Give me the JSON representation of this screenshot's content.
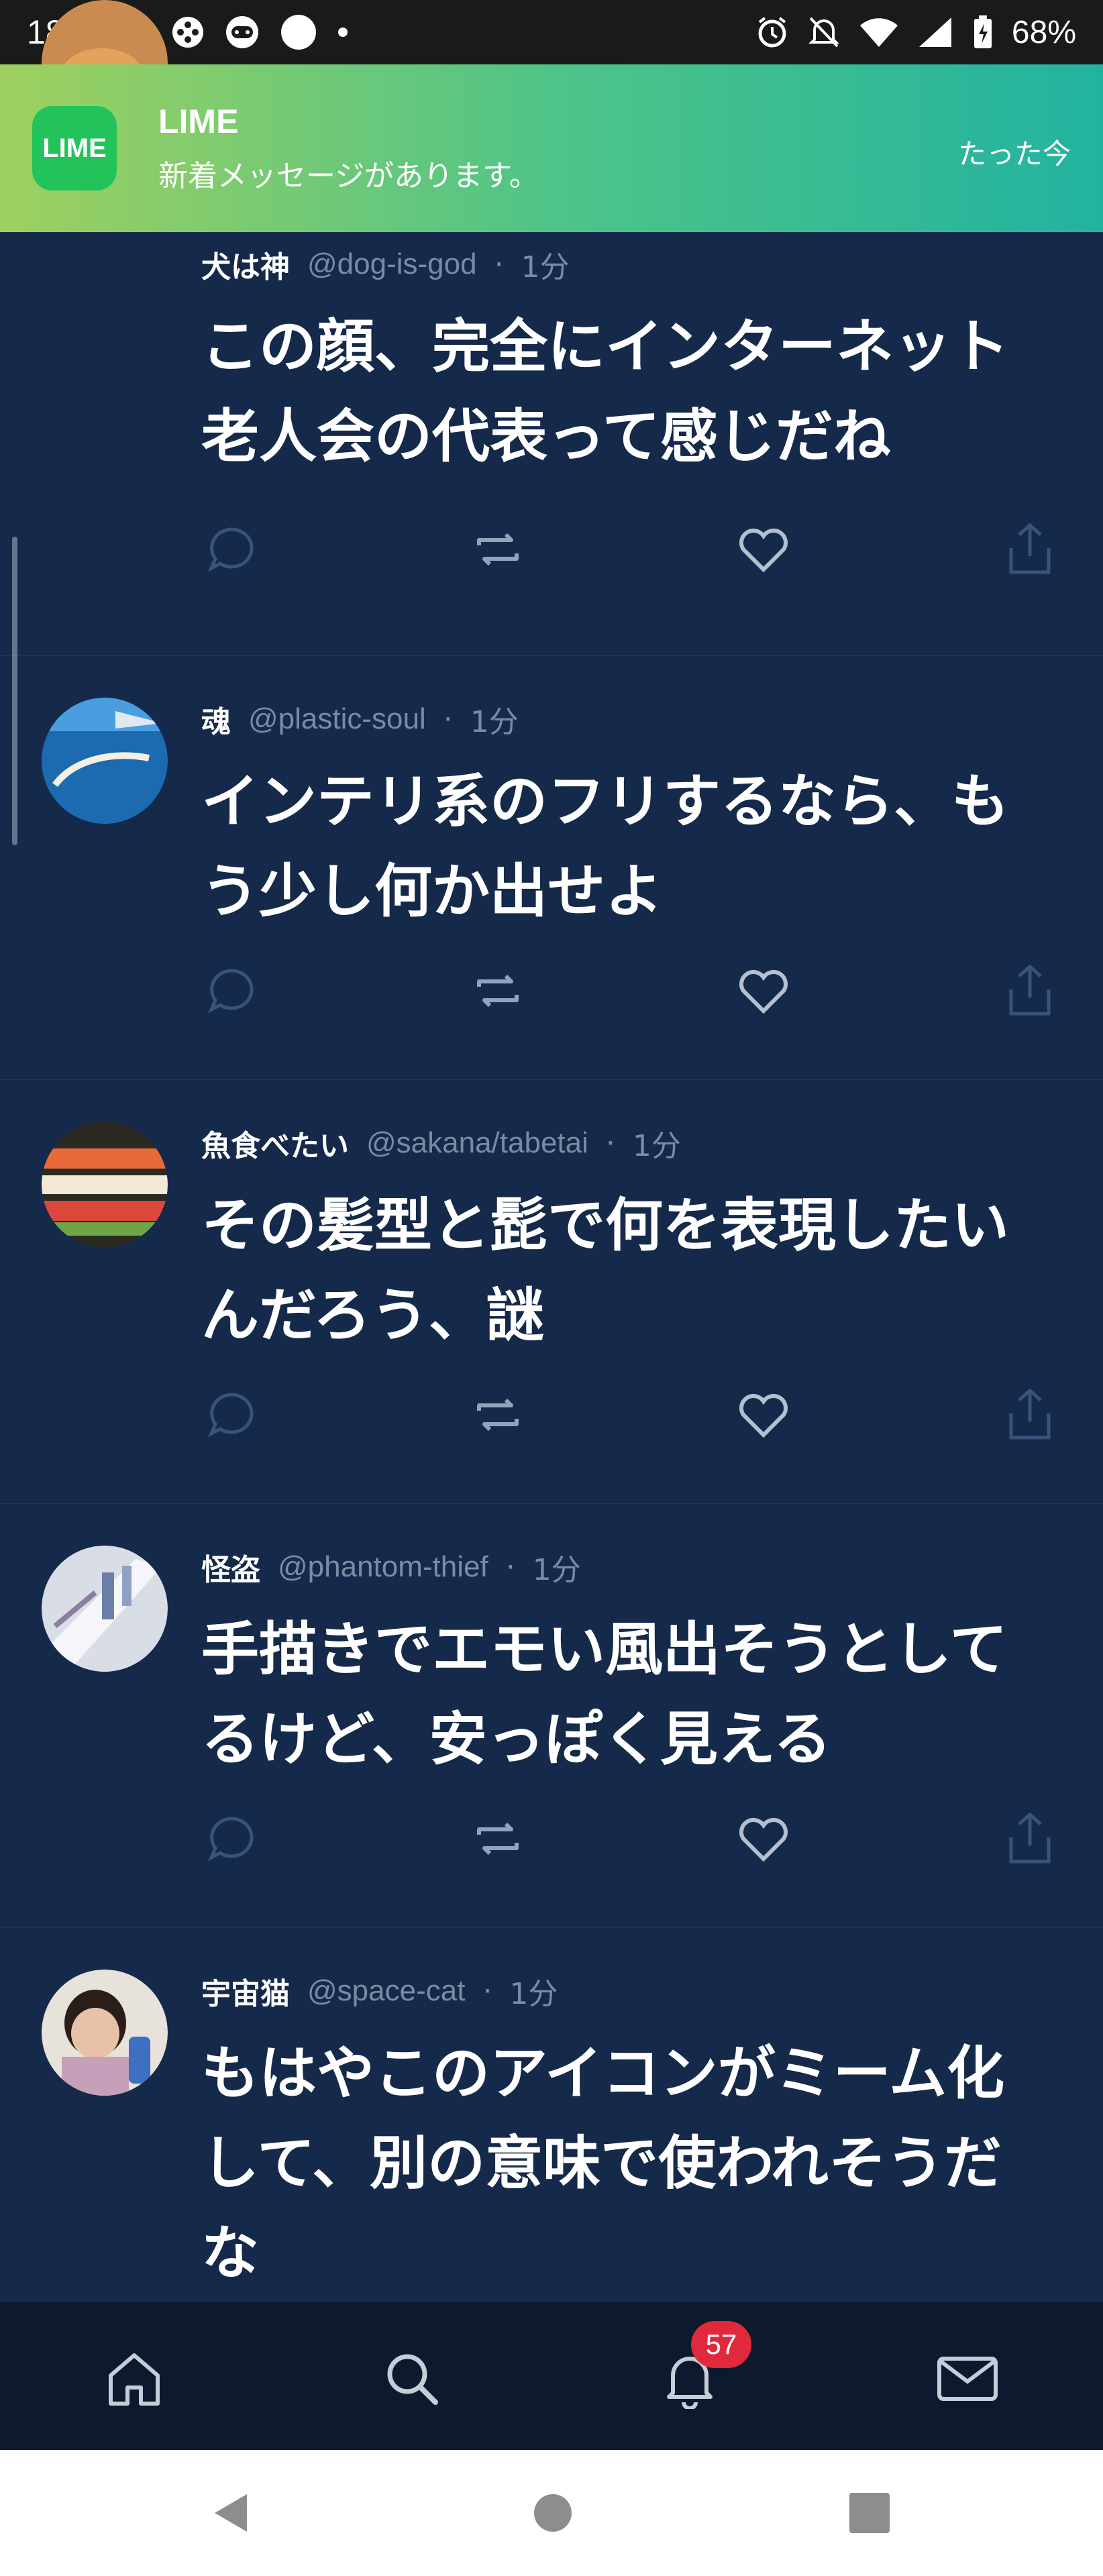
{
  "status_bar": {
    "time": "18:17",
    "battery": "68%",
    "icons": [
      "sim-card-icon",
      "game-controller-icon",
      "game-controller-icon",
      "circle-icon",
      "dot-icon",
      "alarm-icon",
      "notifications-off-icon",
      "wifi-icon",
      "signal-icon",
      "battery-icon"
    ]
  },
  "notification": {
    "app_logo_text": "LIME",
    "title": "LIME",
    "body": "新着メッセージがあります。",
    "time": "たった今"
  },
  "posts": [
    {
      "name": "犬は神",
      "handle": "@dog-is-god",
      "separator": "·",
      "time": "1分",
      "text_lines": [
        "この顔、完全にインターネット",
        "老人会の代表って感じだね"
      ],
      "avatar": "dog-avatar"
    },
    {
      "name": "魂",
      "handle": "@plastic-soul",
      "separator": "·",
      "time": "1分",
      "text_lines": [
        "インテリ系のフリするなら、も",
        "う少し何か出せよ"
      ],
      "avatar": "earth-avatar"
    },
    {
      "name": "魚食べたい",
      "handle": "@sakana/tabetai",
      "separator": "·",
      "time": "1分",
      "text_lines": [
        "その髪型と髭で何を表現したい",
        "んだろう、謎"
      ],
      "avatar": "sushi-avatar"
    },
    {
      "name": "怪盗",
      "handle": "@phantom-thief",
      "separator": "·",
      "time": "1分",
      "text_lines": [
        "手描きでエモい風出そうとして",
        "るけど、安っぽく見える"
      ],
      "avatar": "window-avatar"
    },
    {
      "name": "宇宙猫",
      "handle": "@space-cat",
      "separator": "·",
      "time": "1分",
      "text_lines": [
        "もはやこのアイコンがミーム化",
        "して、別の意味で使われそうだ",
        "な"
      ],
      "avatar": "baby-avatar"
    }
  ],
  "actions_icons": [
    "reply-icon",
    "repost-icon",
    "like-icon",
    "share-icon"
  ],
  "bottom_nav": {
    "items": [
      "home-icon",
      "search-icon",
      "bell-icon",
      "mail-icon"
    ],
    "notification_badge": "57"
  },
  "colors": {
    "background": "#15294a",
    "bottom_nav": "#0d1a2d",
    "badge": "#e1283c",
    "muted_text": "#7c8aa2"
  }
}
